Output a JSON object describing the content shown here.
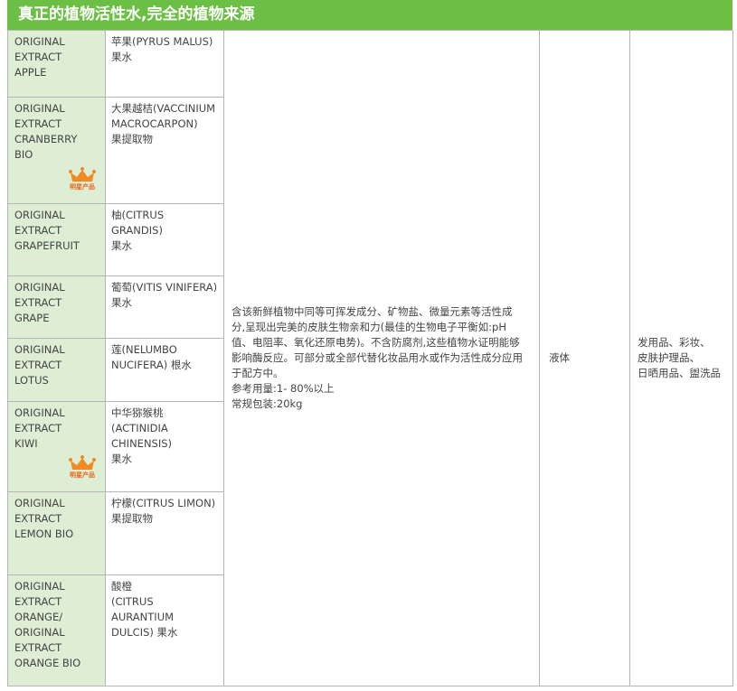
{
  "header": {
    "title": "真正的植物活性水,完全的植物来源"
  },
  "rows": [
    {
      "en": "ORIGINAL\nEXTRACT\nAPPLE",
      "cn": "苹果(PYRUS MALUS)\n果水",
      "star": false
    },
    {
      "en": "ORIGINAL\nEXTRACT\nCRANBERRY\nBIO",
      "cn": "大果越桔(VACCINIUM\nMACROCARPON)\n果提取物",
      "star": true
    },
    {
      "en": "ORIGINAL\nEXTRACT\nGRAPEFRUIT",
      "cn": "柚(CITRUS GRANDIS)\n果水",
      "star": false
    },
    {
      "en": "ORIGINAL\nEXTRACT\nGRAPE",
      "cn": "葡萄(VITIS VINIFERA)\n果水",
      "star": false
    },
    {
      "en": "ORIGINAL\nEXTRACT\nLOTUS",
      "cn": "莲(NELUMBO\nNUCIFERA) 根水",
      "star": false
    },
    {
      "en": "ORIGINAL\nEXTRACT\nKIWI",
      "cn": "中华猕猴桃\n(ACTINIDIA CHINENSIS)\n果水",
      "star": true
    },
    {
      "en": "ORIGINAL\nEXTRACT\nLEMON BIO",
      "cn": "柠檬(CITRUS LIMON)\n果提取物",
      "star": false
    },
    {
      "en": "ORIGINAL\nEXTRACT\nORANGE/\nORIGINAL\nEXTRACT\nORANGE BIO",
      "cn": "酸橙\n(CITRUS AURANTIUM\nDULCIS) 果水",
      "star": false
    }
  ],
  "badge": {
    "label": "明星产品",
    "color": "#f08a24"
  },
  "description": "含该新鲜植物中同等可挥发成分、矿物盐、微量元素等活性成分,呈现出完美的皮肤生物亲和力(最佳的生物电子平衡如:pH值、电阻率、氧化还原电势)。不含防腐剂,这些植物水证明能够影响酶反应。可部分或全部代替化妆品用水或作为活性成分应用于配方中。\n参考用量:1- 80%以上\n常规包装:20kg",
  "form": "液体",
  "application": "发用品、彩妆、\n皮肤护理品、\n日晒用品、盥洗品",
  "colors": {
    "header": "#6cbf45",
    "name_cell": "#deeed5"
  }
}
